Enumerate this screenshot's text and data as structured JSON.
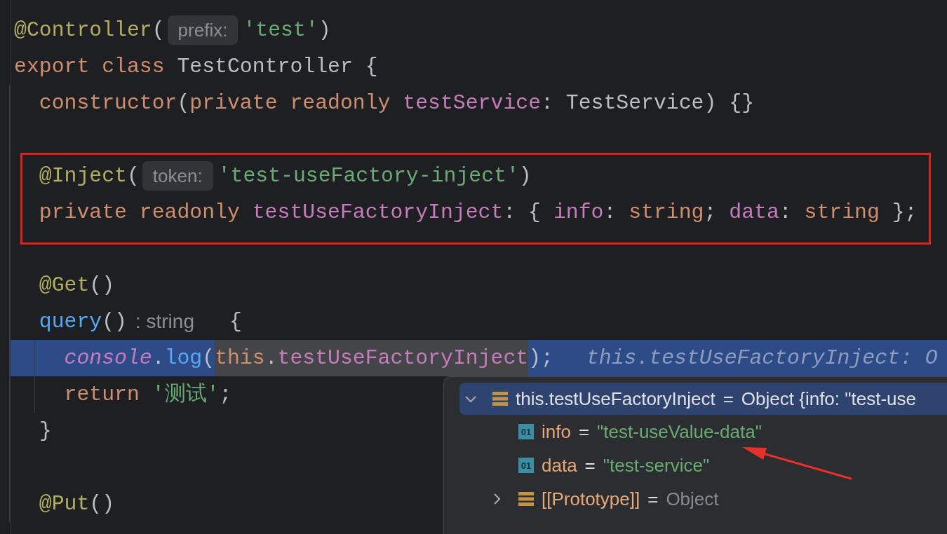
{
  "editor": {
    "lines": [
      {
        "kind": "code",
        "execution_point": false,
        "segments": [
          {
            "kind": "code",
            "tokens": [
              {
                "text": "@Controller",
                "kind": "annotation"
              },
              {
                "text": "(",
                "kind": "plain"
              }
            ]
          },
          {
            "kind": "param_hint",
            "text": "prefix:"
          },
          {
            "kind": "code",
            "tokens": [
              {
                "text": "'test'",
                "kind": "string"
              },
              {
                "text": ")",
                "kind": "plain"
              }
            ]
          }
        ]
      },
      {
        "kind": "code",
        "execution_point": false,
        "segments": [
          {
            "kind": "code",
            "tokens": [
              {
                "text": "export class ",
                "kind": "keyword"
              },
              {
                "text": "TestController {",
                "kind": "plain"
              }
            ]
          }
        ],
        "children": [
          {
            "kind": "code",
            "execution_point": false,
            "boxed": false,
            "segments": [
              {
                "kind": "code",
                "tokens": [
                  {
                    "text": "constructor",
                    "kind": "keyword"
                  },
                  {
                    "text": "(",
                    "kind": "plain"
                  },
                  {
                    "text": "private readonly ",
                    "kind": "keyword"
                  },
                  {
                    "text": "testService",
                    "kind": "field"
                  },
                  {
                    "text": ": TestService) {}",
                    "kind": "plain"
                  }
                ]
              }
            ]
          },
          {
            "kind": "blank",
            "execution_point": false,
            "boxed": false
          },
          {
            "kind": "code",
            "execution_point": false,
            "boxed": true,
            "segments": [
              {
                "kind": "code",
                "tokens": [
                  {
                    "text": "@Inject",
                    "kind": "annotation"
                  },
                  {
                    "text": "(",
                    "kind": "plain"
                  }
                ]
              },
              {
                "kind": "param_hint",
                "text": "token:"
              },
              {
                "kind": "code",
                "tokens": [
                  {
                    "text": "'test-useFactory-inject'",
                    "kind": "string"
                  },
                  {
                    "text": ")",
                    "kind": "plain"
                  }
                ]
              }
            ]
          },
          {
            "kind": "code",
            "execution_point": false,
            "boxed": true,
            "segments": [
              {
                "kind": "code",
                "tokens": [
                  {
                    "text": "private readonly ",
                    "kind": "keyword"
                  },
                  {
                    "text": "testUseFactoryInject",
                    "kind": "field"
                  },
                  {
                    "text": ": { ",
                    "kind": "plain"
                  },
                  {
                    "text": "info",
                    "kind": "field"
                  },
                  {
                    "text": ": ",
                    "kind": "plain"
                  },
                  {
                    "text": "string",
                    "kind": "keyword"
                  },
                  {
                    "text": "; ",
                    "kind": "plain"
                  },
                  {
                    "text": "data",
                    "kind": "field"
                  },
                  {
                    "text": ": ",
                    "kind": "plain"
                  },
                  {
                    "text": "string",
                    "kind": "keyword"
                  },
                  {
                    "text": " };",
                    "kind": "plain"
                  }
                ]
              }
            ]
          },
          {
            "kind": "blank",
            "execution_point": false,
            "boxed": false
          },
          {
            "kind": "code",
            "execution_point": false,
            "boxed": false,
            "segments": [
              {
                "kind": "code",
                "tokens": [
                  {
                    "text": "@Get",
                    "kind": "annotation"
                  },
                  {
                    "text": "()",
                    "kind": "plain"
                  }
                ]
              }
            ]
          },
          {
            "kind": "code",
            "execution_point": false,
            "boxed": false,
            "segments": [
              {
                "kind": "code",
                "tokens": [
                  {
                    "text": "query",
                    "kind": "method"
                  },
                  {
                    "text": "()",
                    "kind": "plain"
                  }
                ]
              },
              {
                "kind": "type_hint",
                "text": ": string"
              },
              {
                "kind": "code",
                "tokens": [
                  {
                    "text": "{",
                    "kind": "plain"
                  }
                ]
              }
            ],
            "children": [
              {
                "kind": "code",
                "execution_point": true,
                "segments": [
                  {
                    "kind": "code",
                    "selected": false,
                    "tokens": [
                      {
                        "text": "console",
                        "kind": "static_field"
                      },
                      {
                        "text": ".",
                        "kind": "plain"
                      },
                      {
                        "text": "log",
                        "kind": "method"
                      },
                      {
                        "text": "(",
                        "kind": "plain"
                      }
                    ]
                  },
                  {
                    "kind": "code",
                    "selected": true,
                    "tokens": [
                      {
                        "text": "this",
                        "kind": "keyword"
                      },
                      {
                        "text": ".",
                        "kind": "plain"
                      },
                      {
                        "text": "testUseFactoryInject",
                        "kind": "field"
                      }
                    ]
                  },
                  {
                    "kind": "code",
                    "selected": false,
                    "tokens": [
                      {
                        "text": ");",
                        "kind": "plain"
                      }
                    ]
                  },
                  {
                    "kind": "inline_value",
                    "text": "this.testUseFactoryInject: O"
                  }
                ]
              },
              {
                "kind": "code",
                "execution_point": false,
                "segments": [
                  {
                    "kind": "code",
                    "tokens": [
                      {
                        "text": "return ",
                        "kind": "keyword"
                      },
                      {
                        "text": "'测试'",
                        "kind": "string"
                      },
                      {
                        "text": ";",
                        "kind": "plain"
                      }
                    ]
                  }
                ]
              }
            ]
          },
          {
            "kind": "code",
            "execution_point": false,
            "boxed": false,
            "segments": [
              {
                "kind": "code",
                "tokens": [
                  {
                    "text": "}",
                    "kind": "plain"
                  }
                ]
              }
            ]
          },
          {
            "kind": "blank",
            "execution_point": false,
            "boxed": false
          },
          {
            "kind": "code",
            "execution_point": false,
            "boxed": false,
            "segments": [
              {
                "kind": "code",
                "tokens": [
                  {
                    "text": "@Put",
                    "kind": "annotation"
                  },
                  {
                    "text": "()",
                    "kind": "plain"
                  }
                ]
              }
            ]
          }
        ]
      }
    ]
  },
  "debug_popup": {
    "rows": [
      {
        "kind": "object",
        "expanded": true,
        "selected": true,
        "name": "this.testUseFactoryInject",
        "operator": "=",
        "value": "Object {info: \"test-use",
        "children": [
          {
            "kind": "primitive",
            "selected": false,
            "type_badge": "01",
            "name": "info",
            "operator": "=",
            "value": "\"test-useValue-data\""
          },
          {
            "kind": "primitive",
            "selected": false,
            "type_badge": "01",
            "name": "data",
            "operator": "=",
            "value": "\"test-service\""
          },
          {
            "kind": "object",
            "expanded": false,
            "selected": false,
            "name": "[[Prototype]]",
            "operator": "=",
            "value": "Object"
          }
        ]
      }
    ]
  },
  "annotations": [
    {
      "kind": "arrow"
    }
  ]
}
